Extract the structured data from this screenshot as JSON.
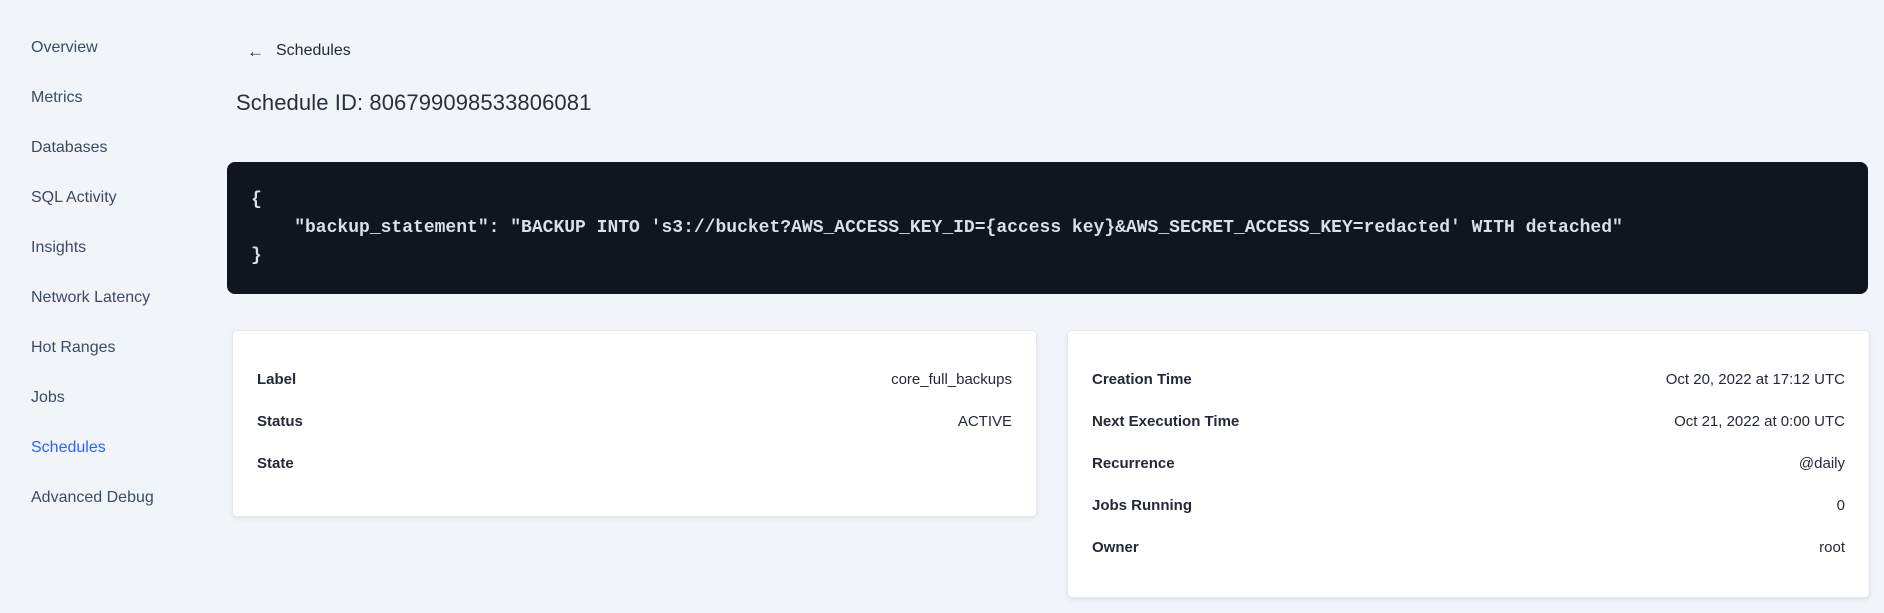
{
  "colors": {
    "page_background": "#f1f5f9",
    "accent_blue": "#2962ff",
    "text_dark": "#242a35",
    "code_background": "#10151e",
    "code_text": "#d9dfe8",
    "card_background": "#ffffff"
  },
  "sidebar": {
    "items": [
      {
        "label": "Overview"
      },
      {
        "label": "Metrics"
      },
      {
        "label": "Databases"
      },
      {
        "label": "SQL Activity"
      },
      {
        "label": "Insights"
      },
      {
        "label": "Network Latency"
      },
      {
        "label": "Hot Ranges"
      },
      {
        "label": "Jobs"
      },
      {
        "label": "Schedules",
        "active": true
      },
      {
        "label": "Advanced Debug"
      }
    ]
  },
  "breadcrumb": {
    "back_icon": "←",
    "back_label": "Schedules"
  },
  "page": {
    "title": "Schedule ID: 806799098533806081"
  },
  "code_block": {
    "lines": [
      "{",
      "    \"backup_statement\": \"BACKUP INTO 's3://bucket?AWS_ACCESS_KEY_ID={access key}&AWS_SECRET_ACCESS_KEY=redacted' WITH detached\"",
      "}"
    ]
  },
  "cards": {
    "left": {
      "rows": [
        {
          "label": "Label",
          "value": "core_full_backups"
        },
        {
          "label": "Status",
          "value": "ACTIVE"
        },
        {
          "label": "State",
          "value": ""
        }
      ]
    },
    "right": {
      "rows": [
        {
          "label": "Creation Time",
          "value": "Oct 20, 2022 at 17:12 UTC"
        },
        {
          "label": "Next Execution Time",
          "value": "Oct 21, 2022 at 0:00 UTC"
        },
        {
          "label": "Recurrence",
          "value": "@daily"
        },
        {
          "label": "Jobs Running",
          "value": "0"
        },
        {
          "label": "Owner",
          "value": "root"
        }
      ]
    }
  }
}
